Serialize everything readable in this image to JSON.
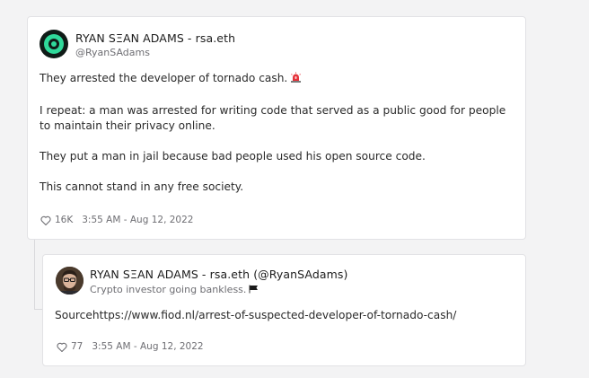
{
  "main_post": {
    "author_name": "RYAN SΞAN ADAMS - rsa.eth",
    "handle": "@RyanSAdams",
    "paragraphs": [
      "They arrested the developer of tornado cash.",
      "I repeat: a man was arrested for writing code that served as a public good for people to maintain their privacy online.",
      "They put a man in jail because bad people used his open source code.",
      "This cannot stand in any free society."
    ],
    "first_paragraph_emoji": "siren-emoji",
    "like_count": "16K",
    "timestamp": "3:55 AM - Aug 12, 2022"
  },
  "reply_post": {
    "author_line": "RYAN SΞAN ADAMS - rsa.eth (@RyanSAdams)",
    "bio": "Crypto investor going bankless.",
    "bio_emoji": "black-flag-emoji",
    "text": "Sourcehttps://www.fiod.nl/arrest-of-suspected-developer-of-tornado-cash/",
    "like_count": "77",
    "timestamp": "3:55 AM - Aug 12, 2022"
  },
  "colors": {
    "background": "#f3f3f4",
    "card": "#ffffff",
    "border": "#e2e2e5",
    "avatar_accent": "#2fd99a",
    "muted_text": "#6e6e73"
  }
}
